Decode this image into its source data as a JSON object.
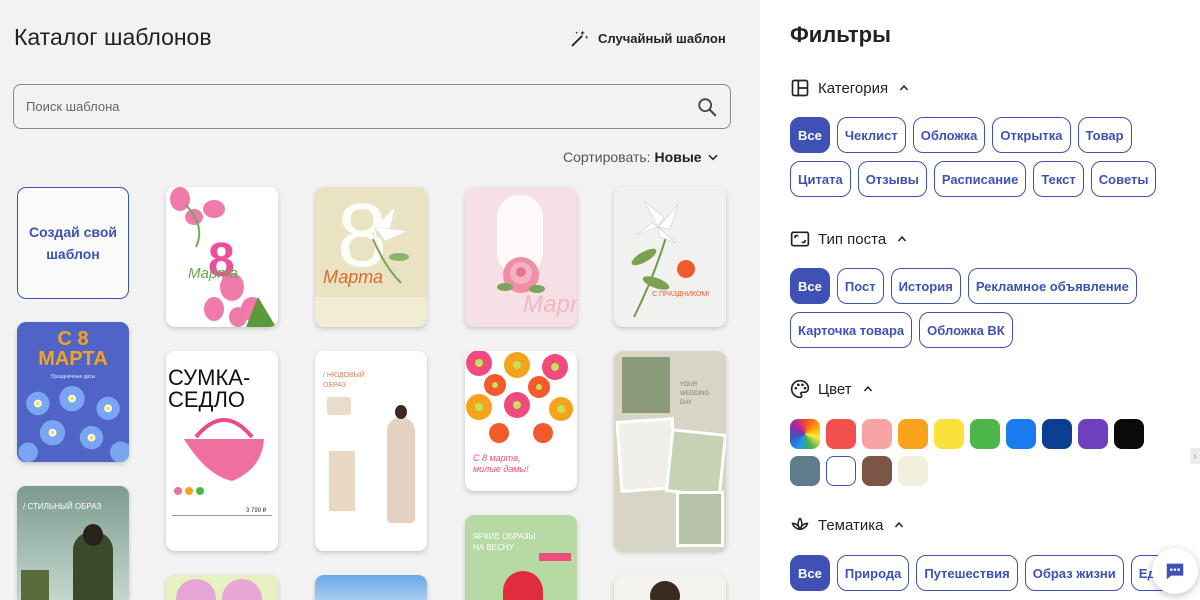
{
  "header": {
    "title": "Каталог шаблонов",
    "random_label": "Случайный шаблон"
  },
  "search": {
    "placeholder": "Поиск шаблона"
  },
  "sort": {
    "label": "Сортировать:",
    "value": "Новые"
  },
  "create": {
    "label": "Создай свой шаблон"
  },
  "templates": {
    "t_march_blue": {
      "line1": "С 8",
      "line2": "МАРТА",
      "small": "Праздничные даты"
    },
    "t_tulips": {
      "big": "8",
      "word": "Марта"
    },
    "t_lily": {
      "big": "8",
      "word": "Марта"
    },
    "t_rose": {
      "word": "Марта"
    },
    "t_lily2": {
      "text": "С ПРАЗДНИКОМ!"
    },
    "t_style": {
      "title": "/ СТИЛЬНЫЙ ОБРАЗ"
    },
    "t_bag": {
      "title": "СУМКА-СЕДЛО",
      "price": "3 799 ₽"
    },
    "t_nude": {
      "title": "/ НЮДОВЫЙ ОБРАЗ"
    },
    "t_flowers": {
      "text": "С 8 марта, милые дамы!"
    },
    "t_wedding": {
      "text": "YOUR WEDDING DAY"
    },
    "t_spring": {
      "text": "ЯРКИЕ ОБРАЗЫ НА ВЕСНУ"
    }
  },
  "filters": {
    "title": "Фильтры",
    "category": {
      "label": "Категория",
      "chips": [
        "Все",
        "Чеклист",
        "Обложка",
        "Открытка",
        "Товар",
        "Цитата",
        "Отзывы",
        "Расписание",
        "Текст",
        "Советы"
      ]
    },
    "post_type": {
      "label": "Тип поста",
      "chips": [
        "Все",
        "Пост",
        "История",
        "Рекламное объявление",
        "Карточка товара",
        "Обложка ВК"
      ]
    },
    "color": {
      "label": "Цвет",
      "swatches": [
        "rainbow",
        "#f44f4f",
        "#f8a3a3",
        "#f9a21b",
        "#f8e23b",
        "#4cb748",
        "#1a7bf0",
        "#0a3f94",
        "#6f3fbf",
        "#0a0a0a",
        "#607d8b",
        "#ffffff",
        "#7b5546",
        "#f1f0dc"
      ]
    },
    "theme": {
      "label": "Тематика",
      "chips": [
        "Все",
        "Природа",
        "Путешествия",
        "Образ жизни",
        "Еда"
      ]
    }
  }
}
